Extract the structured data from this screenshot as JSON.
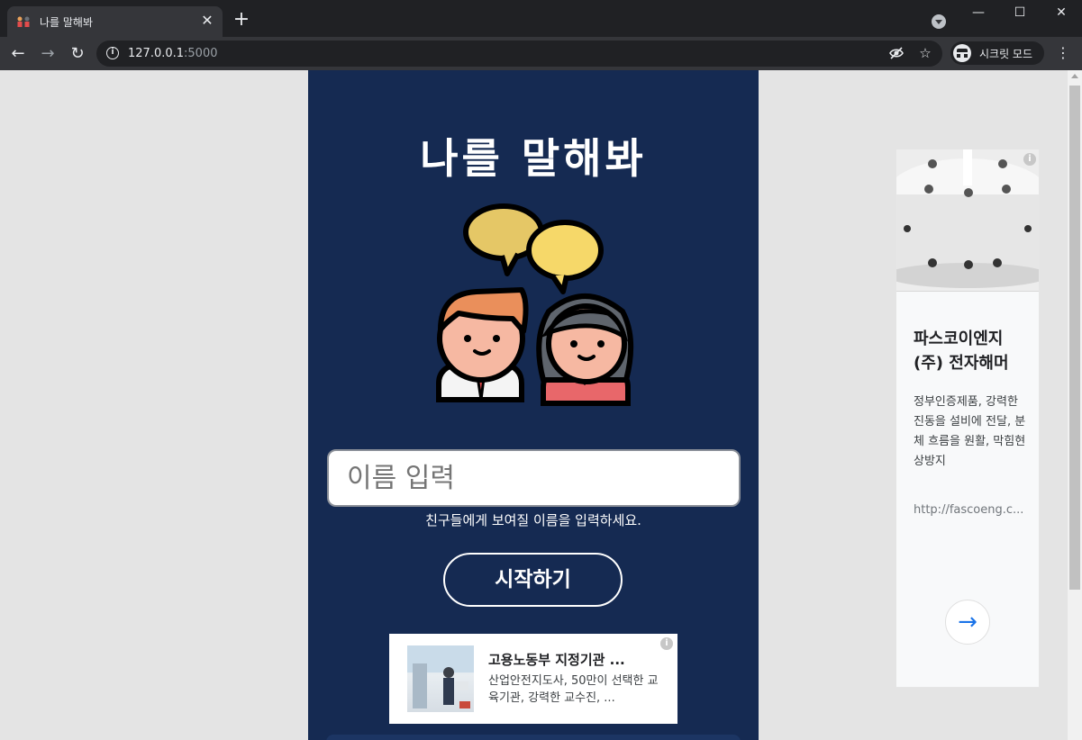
{
  "browser": {
    "tab_title": "나를 말해봐",
    "tab_close": "✕",
    "new_tab": "+",
    "url_host": "127.0.0.1",
    "url_port": ":5000",
    "incognito_label": "시크릿 모드",
    "window_controls": [
      "—",
      "☐",
      "✕"
    ]
  },
  "app": {
    "title": "나를 말해봐",
    "name_placeholder": "이름 입력",
    "name_value": "",
    "hint": "친구들에게 보여질 이름을 입력하세요.",
    "start_label": "시작하기"
  },
  "ad_bottom": {
    "title": "고용노동부 지정기관 ...",
    "description": "산업안전지도사, 50만이 선택한 교육기관, 강력한 교수진, ..."
  },
  "ad_side": {
    "title": "파스코이엔지(주) 전자해머",
    "description": "정부인증제품, 강력한 진동을 설비에 전달, 분체 흐름을 원활, 막힘현상방지",
    "url": "http://fascoeng.c..."
  },
  "colors": {
    "app_background": "#152a52",
    "page_background": "#e4e4e4",
    "chrome_dark": "#202124",
    "accent_link": "#1a73e8"
  },
  "icons": [
    "favicon-icon",
    "close-icon",
    "plus-icon",
    "back-icon",
    "forward-icon",
    "reload-icon",
    "info-icon",
    "eye-off-icon",
    "star-icon",
    "incognito-icon",
    "menu-icon",
    "arrow-right-icon",
    "ad-info-icon"
  ]
}
